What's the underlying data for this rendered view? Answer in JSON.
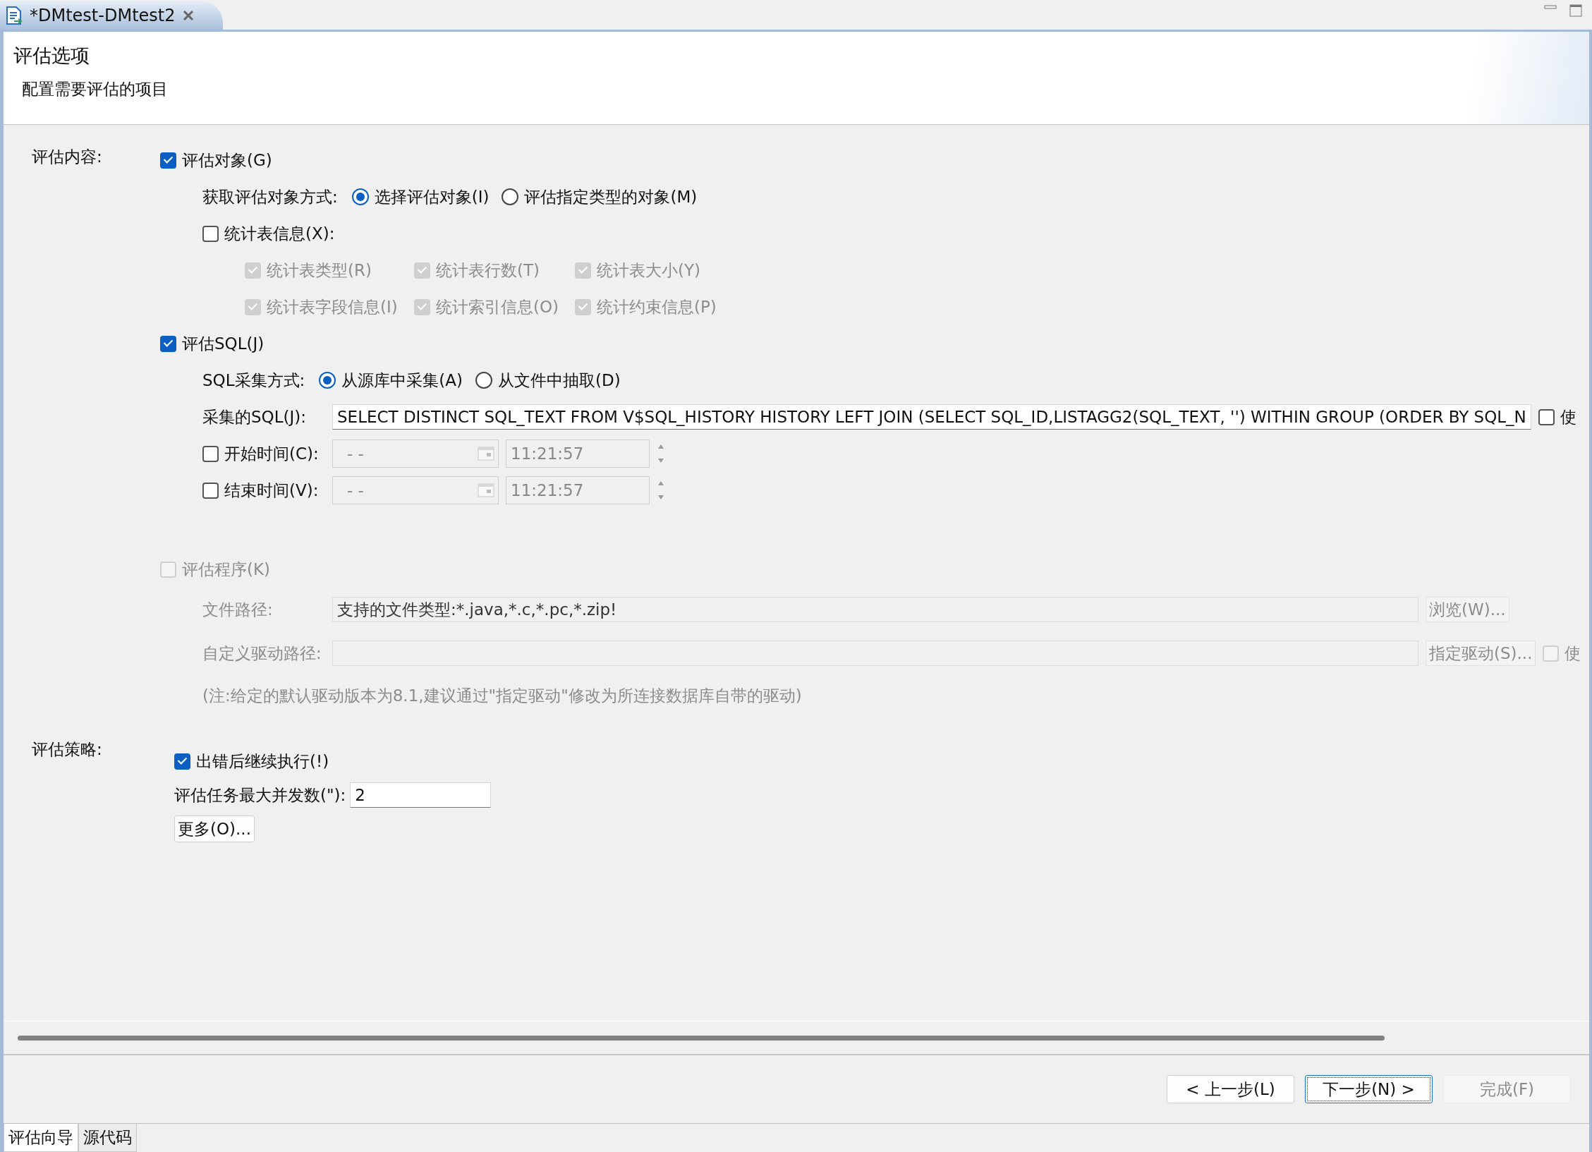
{
  "editor_tab": {
    "title": "*DMtest-DMtest2"
  },
  "header": {
    "title": "评估选项",
    "subtitle": "配置需要评估的项目"
  },
  "content": {
    "label": "评估内容:",
    "objects": {
      "label": "评估对象(G)",
      "checked": true
    },
    "method": {
      "label": "获取评估对象方式:",
      "options": [
        {
          "label": "选择评估对象(I)",
          "selected": true
        },
        {
          "label": "评估指定类型的对象(M)",
          "selected": false
        }
      ]
    },
    "stats": {
      "label": "统计表信息(X):",
      "checked": false
    },
    "stat_options": [
      {
        "label": "统计表类型(R)",
        "checked": true,
        "disabled": true
      },
      {
        "label": "统计表行数(T)",
        "checked": true,
        "disabled": true
      },
      {
        "label": "统计表大小(Y)",
        "checked": true,
        "disabled": true
      },
      {
        "label": "统计表字段信息(I)",
        "checked": true,
        "disabled": true
      },
      {
        "label": "统计索引信息(O)",
        "checked": true,
        "disabled": true
      },
      {
        "label": "统计约束信息(P)",
        "checked": true,
        "disabled": true
      }
    ],
    "sql": {
      "label": "评估SQL(J)",
      "checked": true
    },
    "sql_method": {
      "label": "SQL采集方式:",
      "options": [
        {
          "label": "从源库中采集(A)",
          "selected": true
        },
        {
          "label": "从文件中抽取(D)",
          "selected": false
        }
      ]
    },
    "sql_text": {
      "label": "采集的SQL(J):",
      "value": "SELECT DISTINCT SQL_TEXT FROM V$SQL_HISTORY HISTORY LEFT JOIN (SELECT SQL_ID,LISTAGG2(SQL_TEXT, '') WITHIN GROUP (ORDER BY SQL_N",
      "option": {
        "label": "使",
        "checked": false
      }
    },
    "time_rows": [
      {
        "label": "开始时间(C):",
        "checked": false,
        "date": "-  -",
        "time": "11:21:57"
      },
      {
        "label": "结束时间(V):",
        "checked": false,
        "date": "-  -",
        "time": "11:21:57"
      }
    ],
    "program": {
      "label": "评估程序(K)",
      "checked": false,
      "disabled": true
    },
    "file_path": {
      "label": "文件路径:",
      "value": "支持的文件类型:*.java,*.c,*.pc,*.zip!",
      "button": "浏览(W)..."
    },
    "driver_path": {
      "label": "自定义驱动路径:",
      "button": "指定驱动(S)...",
      "option": {
        "label": "使",
        "checked": false
      }
    },
    "note": "(注:给定的默认驱动版本为8.1,建议通过\"指定驱动\"修改为所连接数据库自带的驱动)"
  },
  "strategy": {
    "label": "评估策略:",
    "continue": {
      "label": "出错后继续执行(!)",
      "checked": true
    },
    "concurrency": {
      "label": "评估任务最大并发数(\"):",
      "value": "2"
    },
    "more_button": "更多(O)..."
  },
  "buttons": [
    {
      "label": "< 上一步(L)",
      "disabled": false,
      "focused": false
    },
    {
      "label": "下一步(N) >",
      "disabled": false,
      "focused": true
    },
    {
      "label": "完成(F)",
      "disabled": true,
      "focused": false
    }
  ],
  "bottom_tabs": [
    {
      "label": "评估向导",
      "selected": true
    },
    {
      "label": "源代码",
      "selected": false
    }
  ]
}
